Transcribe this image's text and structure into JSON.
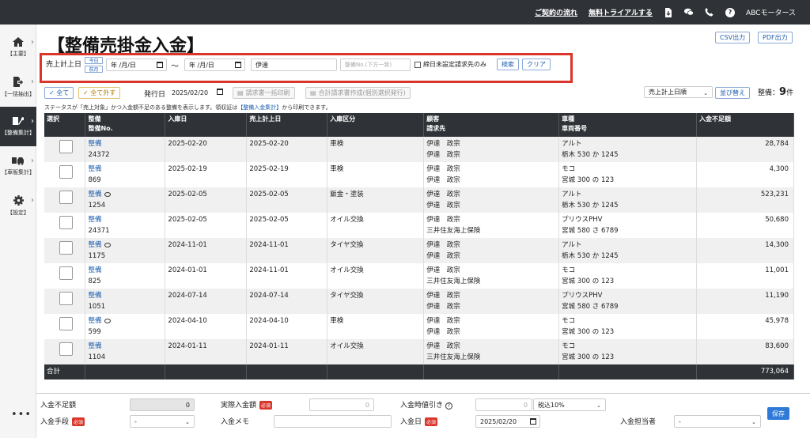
{
  "topbar": {
    "links": [
      "ご契約の流れ",
      "無料トライアルする"
    ],
    "company": "ABCモータース",
    "help_icon_glyph": "?"
  },
  "sidebar": {
    "items": [
      {
        "label": "【主要】",
        "icon": "home-icon",
        "glyph": "⌂"
      },
      {
        "label": "【一括抽出】",
        "icon": "export-icon",
        "glyph": "➜"
      },
      {
        "label": "【整備集計】",
        "icon": "wrench-icon",
        "glyph": "⚒",
        "active": true
      },
      {
        "label": "【車販集計】",
        "icon": "car-icon",
        "glyph": "⛟"
      },
      {
        "label": "【設定】",
        "icon": "gear-icon",
        "glyph": "⚙"
      }
    ],
    "more": "•••"
  },
  "page": {
    "title": "【整備売掛金入金】",
    "csv_button": "CSV出力",
    "pdf_button": "PDF出力"
  },
  "search": {
    "date_label": "売上計上日",
    "today_button": "今日",
    "prev_month_button": "前月",
    "date_from_placeholder": "年 /月/日",
    "tilde": "〜",
    "date_to_placeholder": "年 /月/日",
    "customer_value": "伊達",
    "seibi_no_placeholder": "整備No.(下方一致)",
    "unset_closing_label": "締日未設定請求先のみ",
    "search_button": "検索",
    "clear_button": "クリア"
  },
  "toolbar": {
    "select_all": "✓ 全て",
    "deselect_all": "✓ 全て外す",
    "issue_date_label": "発行日",
    "issue_date_value": "2025/02/20",
    "bulk_print_button": "請求書一括印刷",
    "combined_invoice_button": "合計請求書作成(個別選択発行)",
    "sort_value": "売上計上日順",
    "sort_button": "並び替え",
    "count_label": "整備：",
    "count_value": "9",
    "count_unit": "件"
  },
  "note": {
    "text_before": "ステータスが「売上対象」かつ入金額不足のある整備を表示します。領収証は",
    "link": "【整備入金集計】",
    "text_after": "から印刷できます。"
  },
  "table": {
    "headers": {
      "select": "選択",
      "seibi_top": "整備",
      "seibi_bottom": "整備No.",
      "in_date": "入庫日",
      "sales_date": "売上計上日",
      "category": "入庫区分",
      "customer_top": "顧客",
      "customer_bottom": "請求先",
      "vehicle_top": "車種",
      "vehicle_bottom": "車両番号",
      "shortfall": "入金不足額"
    },
    "rows": [
      {
        "seibi": "整備",
        "no": "24372",
        "memo": false,
        "in_date": "2025-02-20",
        "sales_date": "2025-02-20",
        "category": "車検",
        "customer": "伊達　政宗",
        "billing": "伊達　政宗",
        "vehicle": "アルト",
        "plate": "栃木 530 か 1245",
        "amount": "28,784"
      },
      {
        "seibi": "整備",
        "no": "869",
        "memo": false,
        "in_date": "2025-02-19",
        "sales_date": "2025-02-19",
        "category": "車検",
        "customer": "伊達　政宗",
        "billing": "伊達　政宗",
        "vehicle": "モコ",
        "plate": "宮城 300 の 123",
        "amount": "4,300"
      },
      {
        "seibi": "整備",
        "no": "1254",
        "memo": true,
        "in_date": "2025-02-05",
        "sales_date": "2025-02-05",
        "category": "鈑金・塗装",
        "customer": "伊達　政宗",
        "billing": "伊達　政宗",
        "vehicle": "アルト",
        "plate": "栃木 530 か 1245",
        "amount": "523,231"
      },
      {
        "seibi": "整備",
        "no": "24371",
        "memo": false,
        "in_date": "2025-02-05",
        "sales_date": "2025-02-05",
        "category": "オイル交換",
        "customer": "伊達　政宗",
        "billing": "三井住友海上保険",
        "vehicle": "プリウスPHV",
        "plate": "宮城 580 さ 6789",
        "amount": "50,680"
      },
      {
        "seibi": "整備",
        "no": "1175",
        "memo": true,
        "in_date": "2024-11-01",
        "sales_date": "2024-11-01",
        "category": "タイヤ交換",
        "customer": "伊達　政宗",
        "billing": "伊達　政宗",
        "vehicle": "アルト",
        "plate": "栃木 530 か 1245",
        "amount": "14,300"
      },
      {
        "seibi": "整備",
        "no": "825",
        "memo": false,
        "in_date": "2024-01-01",
        "sales_date": "2024-11-01",
        "category": "オイル交換",
        "customer": "伊達　政宗",
        "billing": "三井住友海上保険",
        "vehicle": "モコ",
        "plate": "宮城 300 の 123",
        "amount": "11,001"
      },
      {
        "seibi": "整備",
        "no": "1051",
        "memo": false,
        "in_date": "2024-07-14",
        "sales_date": "2024-07-14",
        "category": "タイヤ交換",
        "customer": "伊達　政宗",
        "billing": "伊達　政宗",
        "vehicle": "プリウスPHV",
        "plate": "宮城 580 さ 6789",
        "amount": "11,190"
      },
      {
        "seibi": "整備",
        "no": "599",
        "memo": true,
        "in_date": "2024-04-10",
        "sales_date": "2024-04-10",
        "category": "車検",
        "customer": "伊達　政宗",
        "billing": "伊達　政宗",
        "vehicle": "モコ",
        "plate": "宮城 300 の 123",
        "amount": "45,978"
      },
      {
        "seibi": "整備",
        "no": "1104",
        "memo": false,
        "in_date": "2024-01-11",
        "sales_date": "2024-01-11",
        "category": "オイル交換",
        "customer": "伊達　政宗",
        "billing": "三井住友海上保険",
        "vehicle": "モコ",
        "plate": "宮城 300 の 123",
        "amount": "83,600"
      }
    ],
    "total_label": "合計",
    "total_value": "773,064"
  },
  "payment": {
    "shortfall_label": "入金不足額",
    "shortfall_value": "0",
    "actual_label": "実際入金額",
    "actual_placeholder": "0",
    "discount_label": "入金時値引き",
    "discount_info_glyph": "?",
    "discount_placeholder": "0",
    "tax_value": "税込10%",
    "method_label": "入金手段",
    "method_value": "-",
    "memo_label": "入金メモ",
    "date_label": "入金日",
    "date_value": "2025/02/20",
    "staff_label": "入金担当者",
    "staff_value": "-",
    "required_badge": "必須",
    "save_button": "保存"
  }
}
